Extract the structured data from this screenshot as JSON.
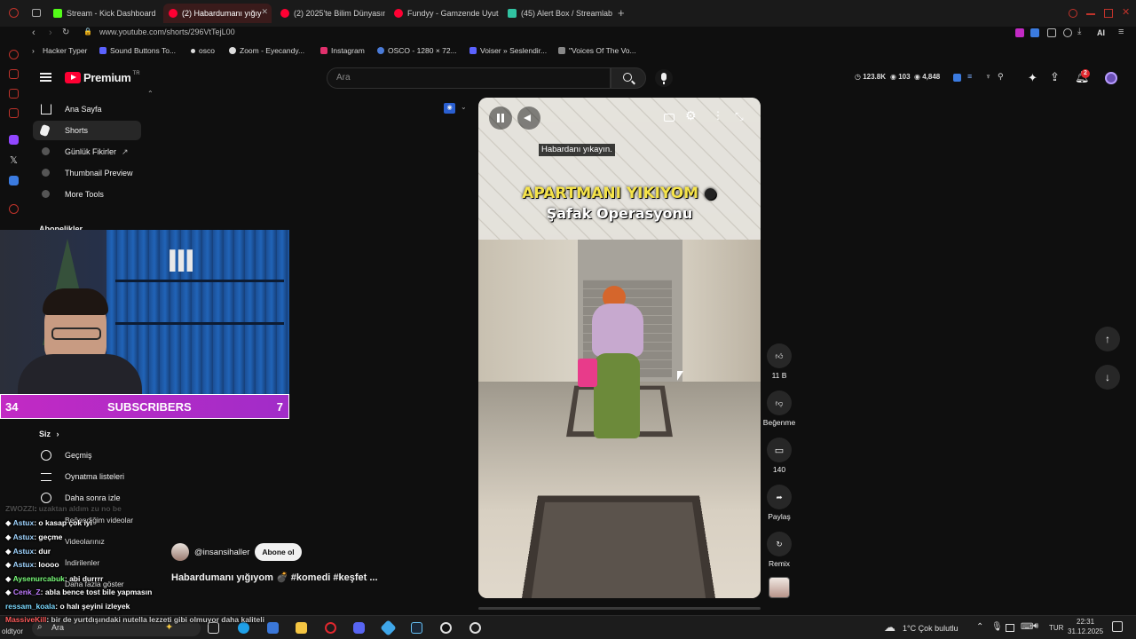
{
  "browser": {
    "tabs": [
      {
        "label": "Stream - Kick Dashboard",
        "color": "#53fc18"
      },
      {
        "label": "(2) Habardumanı yığıy",
        "color": "#ff0033"
      },
      {
        "label": "(2) 2025'te Bilim Dünyasın",
        "color": "#ff0033"
      },
      {
        "label": "Fundyy - Gamzende Uyut",
        "color": "#ff0033"
      },
      {
        "label": "(45) Alert Box / Streamlab",
        "color": "#31c3a2"
      }
    ],
    "new_tab": "+",
    "url": "www.youtube.com/shorts/296VtTejL00",
    "ai_label": "AI"
  },
  "bookmarks": [
    {
      "label": "Hacker Typer",
      "color": "#888"
    },
    {
      "label": "Sound Buttons To...",
      "color": "#5b62ff"
    },
    {
      "label": "osco",
      "color": "#ddd"
    },
    {
      "label": "Zoom - Eyecandy...",
      "color": "#ddd"
    },
    {
      "label": "Instagram",
      "color": "#e1306c"
    },
    {
      "label": "OSCO - 1280 × 72...",
      "color": "#4a7bd8"
    },
    {
      "label": "Voiser » Seslendir...",
      "color": "#5b62ff"
    },
    {
      "label": "\"Voices Of The Vo...",
      "color": "#888"
    }
  ],
  "youtube": {
    "logo_text": "Premium",
    "logo_sup": "TR",
    "search_placeholder": "Ara",
    "stats": {
      "views": "123.8K",
      "viewers": "103",
      "followers": "4,848"
    },
    "notif_count": "2"
  },
  "sidebar": {
    "items": [
      {
        "label": "Ana Sayfa"
      },
      {
        "label": "Shorts"
      },
      {
        "label": "Günlük Fikirler"
      },
      {
        "label": "Thumbnail Preview"
      },
      {
        "label": "More Tools"
      }
    ],
    "section_abonelikler": "Abonelikler",
    "section_siz": "Siz",
    "siz_items": [
      {
        "label": "Geçmiş"
      },
      {
        "label": "Oynatma listeleri"
      },
      {
        "label": "Daha sonra izle"
      },
      {
        "label": "Beğendiğim videolar"
      },
      {
        "label": "Videolarınız"
      },
      {
        "label": "İndirilenler"
      },
      {
        "label": "Daha fazla göster"
      }
    ]
  },
  "overlay": {
    "subs_left": "34",
    "subs_label": "SUBSCRIBERS",
    "subs_right": "7"
  },
  "short": {
    "caption": "Habardanı yıkayın.",
    "title_line1": "APARTMANI YIKIYOM",
    "title_line2": "Şafak Operasyonu",
    "likes": "11 B",
    "dislike_label": "Beğenme",
    "comments": "140",
    "share_label": "Paylaş",
    "remix_label": "Remix",
    "channel": "@insansihaller",
    "subscribe": "Abone ol",
    "video_title": "Habardumanı yığıyom 💣 #komedi #keşfet ..."
  },
  "chat": [
    {
      "user": "ZWOZZI",
      "text": "uzaktan aldım zu no be",
      "color": "#888"
    },
    {
      "user": "Astux",
      "text": "o kasap çok iyi",
      "color": "#9fd4ff"
    },
    {
      "user": "Astux",
      "text": "geçme",
      "color": "#9fd4ff"
    },
    {
      "user": "Astux",
      "text": "dur",
      "color": "#9fd4ff"
    },
    {
      "user": "Astux",
      "text": "loooo",
      "color": "#9fd4ff"
    },
    {
      "user": "Aysenurcabuk",
      "text": "abi durrrr",
      "color": "#7bff7b"
    },
    {
      "user": "Cenk_Z",
      "text": "abla bence tost bile yapmasın",
      "color": "#c07bff"
    },
    {
      "user": "ressam_koala",
      "text": "o halı şeyini izleyek",
      "color": "#7bd9ff"
    },
    {
      "user": "MassiveKill",
      "text": "bir de yurtdışındaki nutella lezzeti gibi olmuyor daha kaliteli",
      "color": "#ff5b5b"
    }
  ],
  "taskbar": {
    "search_label": "Ara",
    "weather": "1°C  Çok bulutlu",
    "lang": "TUR",
    "time": "22:31",
    "date": "31.12.2025",
    "left_label": "oldtyor"
  }
}
